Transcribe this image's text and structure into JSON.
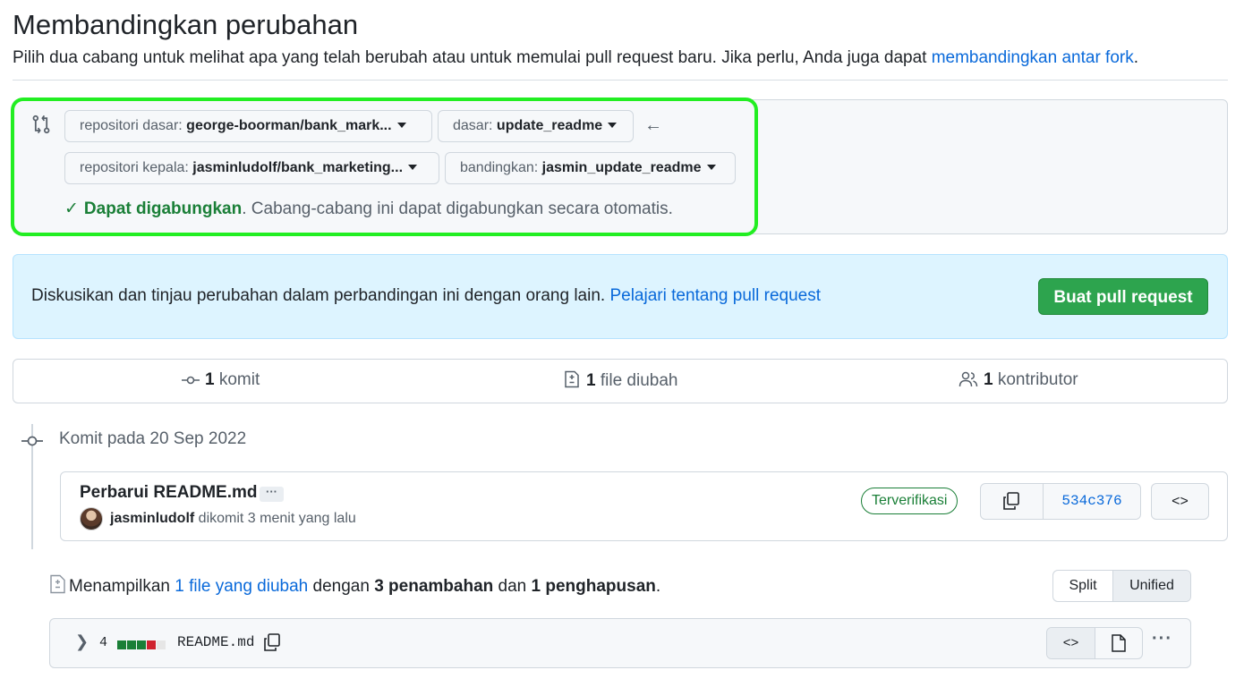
{
  "page": {
    "title": "Membandingkan perubahan",
    "subtitle_text": "Pilih dua cabang untuk melihat apa yang telah berubah atau untuk memulai pull request baru. Jika perlu, Anda juga dapat ",
    "subtitle_link": "membandingkan antar fork",
    "subtitle_end": "."
  },
  "range": {
    "base_repo_prefix": "repositori dasar: ",
    "base_repo_value": "george-boorman/bank_mark...",
    "base_prefix": "dasar: ",
    "base_value": "update_readme",
    "head_repo_prefix": "repositori kepala: ",
    "head_repo_value": "jasminludolf/bank_marketing...",
    "compare_prefix": "bandingkan: ",
    "compare_value": "jasmin_update_readme",
    "merge_check": "✓",
    "merge_status": "Dapat digabungkan",
    "merge_message": ". Cabang-cabang ini dapat digabungkan secara otomatis."
  },
  "blankslate": {
    "text": "Diskusikan dan tinjau perubahan dalam perbandingan ini dengan orang lain. ",
    "link": "Pelajari tentang pull request",
    "button": "Buat pull request"
  },
  "stats": {
    "commits_count": "1",
    "commits_label": " komit",
    "files_count": "1",
    "files_label": " file diubah",
    "contributors_count": "1",
    "contributors_label": " kontributor"
  },
  "timeline": {
    "date_label": "Komit pada 20 Sep 2022",
    "commit_message": "Perbarui README.md",
    "ellipsis": "···",
    "author": "jasminludolf",
    "author_suffix": " dikomit 3 menit yang lalu",
    "verified": "Terverifikasi",
    "sha": "534c376",
    "browse": "<>"
  },
  "files": {
    "summary_prefix": "Menampilkan ",
    "summary_link": "1 file yang diubah",
    "summary_mid1": " dengan ",
    "additions": "3 penambahan",
    "summary_mid2": " dan ",
    "deletions": "1 penghapusan",
    "summary_end": ".",
    "split": "Split",
    "unified": "Unified",
    "file_changes": "4",
    "file_name": "README.md",
    "diffstat": [
      "added",
      "added",
      "added",
      "deleted",
      "neutral"
    ],
    "code_btn": "<>",
    "more": "···"
  },
  "colors": {
    "added": "#1a7f37",
    "deleted": "#cf222e",
    "neutral": "#e6e6e6",
    "highlight": "#22ee22"
  }
}
